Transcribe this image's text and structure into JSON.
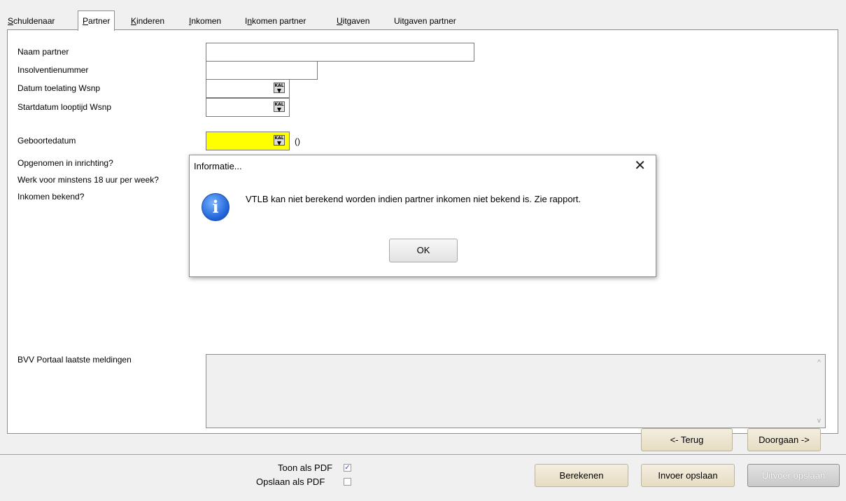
{
  "tabs": [
    {
      "pre": "",
      "ul": "S",
      "post": "chuldenaar"
    },
    {
      "pre": "",
      "ul": "P",
      "post": "artner"
    },
    {
      "pre": "",
      "ul": "K",
      "post": "inderen"
    },
    {
      "pre": "",
      "ul": "I",
      "post": "nkomen"
    },
    {
      "pre": "I",
      "ul": "n",
      "post": "komen partner"
    },
    {
      "pre": "",
      "ul": "U",
      "post": "itgaven"
    },
    {
      "pre": "Uit",
      "ul": "g",
      "post": "aven partner"
    }
  ],
  "active_tab": "Partner",
  "form": {
    "naam_partner": "Naam partner",
    "insolventienummer": "Insolventienummer",
    "datum_toelating": "Datum toelating Wsnp",
    "startdatum_looptijd": "Startdatum looptijd Wsnp",
    "geboortedatum": "Geboortedatum",
    "geboortedatum_suffix": "()",
    "opgenomen": "Opgenomen in inrichting?",
    "werk": "Werk voor minstens 18 uur per week?",
    "inkomen_bekend": "Inkomen bekend?",
    "bvv_label": "BVV Portaal laatste meldingen",
    "cal_icon_text": "KAL"
  },
  "colors": {
    "required_field": "#ffff00",
    "button_bg": "#ece3cc",
    "info_icon": "#1c5ed6"
  },
  "icons": {
    "calendar": "calendar-icon",
    "info": "info-icon",
    "close": "close-icon"
  },
  "nav": {
    "back": "<- Terug",
    "next": "Doorgaan ->"
  },
  "bottom": {
    "toon_pdf": "Toon als PDF",
    "toon_pdf_checked": true,
    "opslaan_pdf": "Opslaan als PDF",
    "opslaan_pdf_checked": false,
    "berekenen": "Berekenen",
    "invoer_opslaan": "Invoer opslaan",
    "uitvoer_opslaan": "Uitvoer opslaan"
  },
  "dialog": {
    "title": "Informatie...",
    "message": "VTLB kan niet berekend worden indien partner inkomen niet bekend is. Zie rapport.",
    "ok": "OK"
  }
}
